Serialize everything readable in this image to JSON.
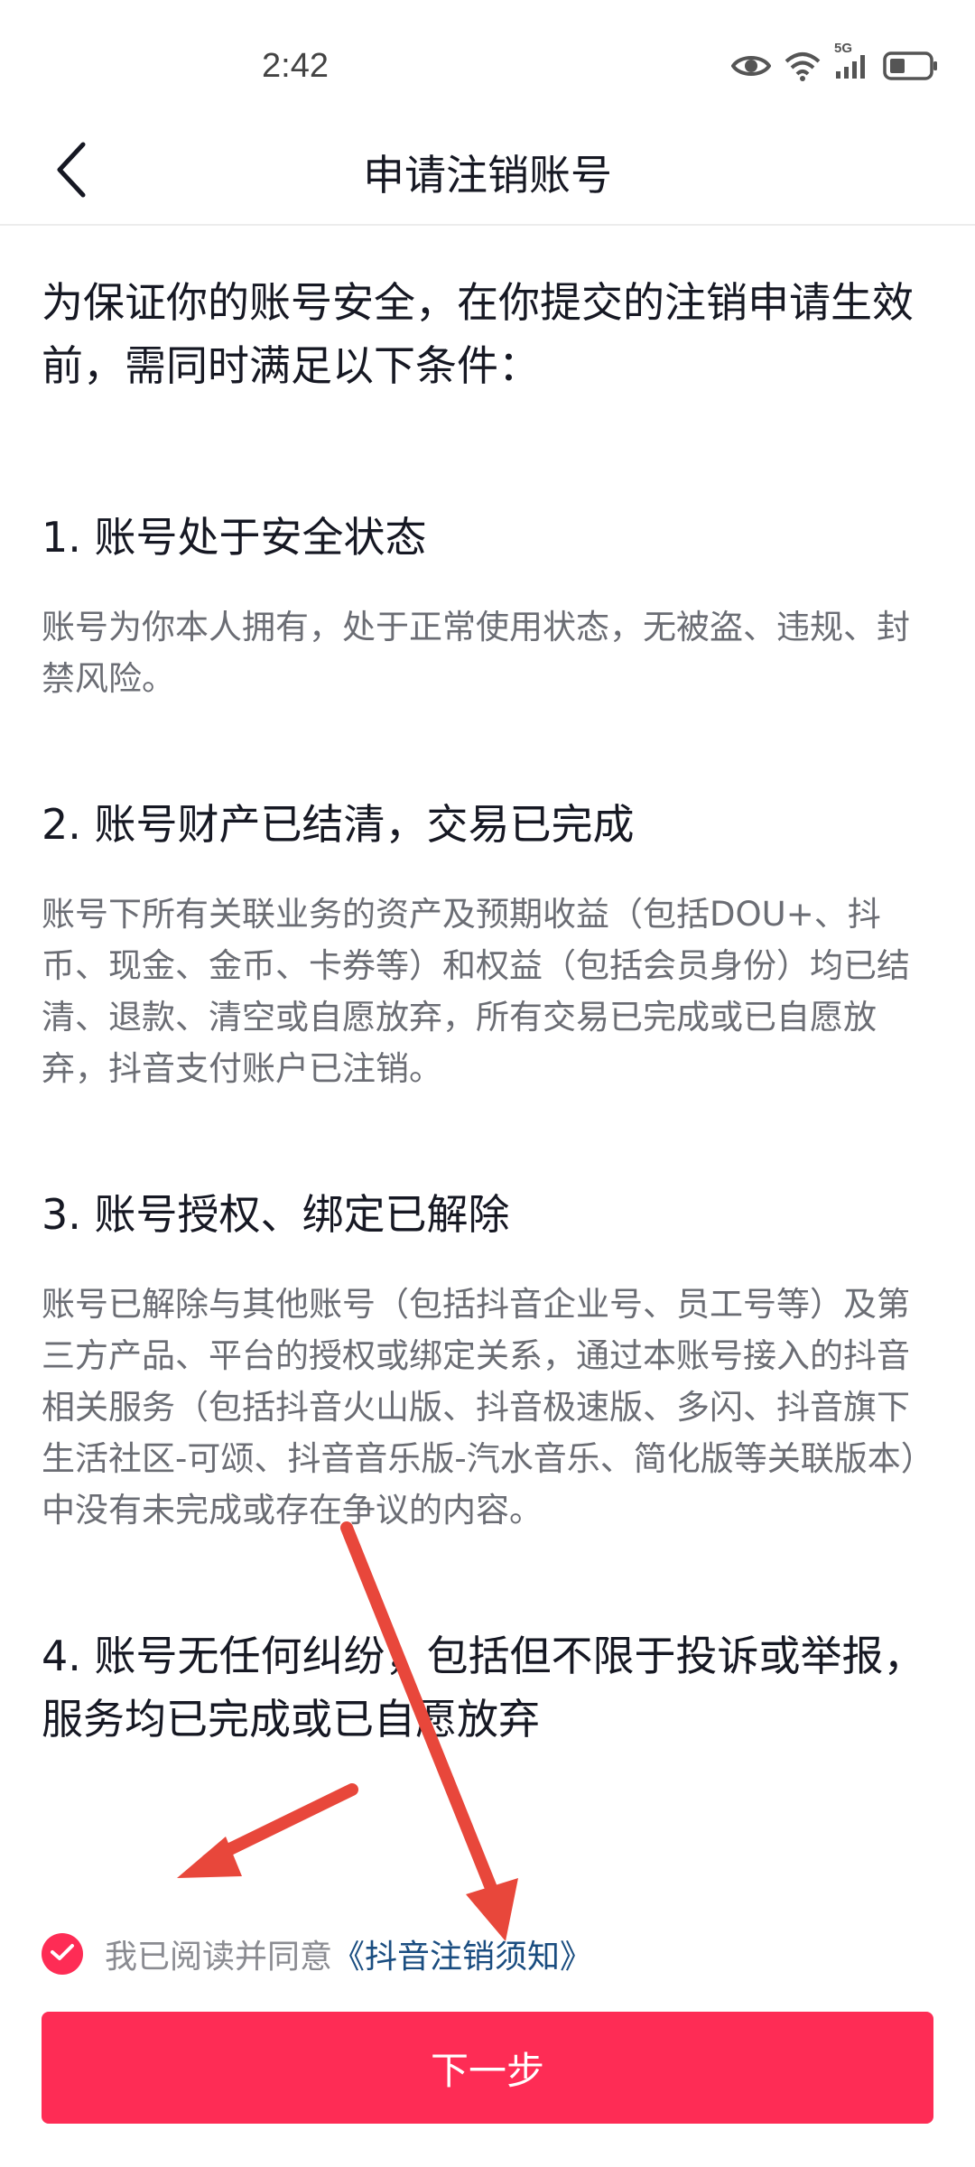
{
  "status_bar": {
    "time": "2:42",
    "network": "5G",
    "icons": [
      "eye-icon",
      "wifi-icon",
      "cellular-signal-icon",
      "battery-icon"
    ]
  },
  "nav": {
    "back_icon": "chevron-left-icon",
    "title": "申请注销账号"
  },
  "content": {
    "intro": "为保证你的账号安全，在你提交的注销申请生效前，需同时满足以下条件：",
    "sections": [
      {
        "heading": "1. 账号处于安全状态",
        "body": "账号为你本人拥有，处于正常使用状态，无被盗、违规、封禁风险。"
      },
      {
        "heading": "2. 账号财产已结清，交易已完成",
        "body": "账号下所有关联业务的资产及预期收益（包括DOU+、抖币、现金、金币、卡券等）和权益（包括会员身份）均已结清、退款、清空或自愿放弃，所有交易已完成或已自愿放弃，抖音支付账户已注销。"
      },
      {
        "heading": "3. 账号授权、绑定已解除",
        "body": "账号已解除与其他账号（包括抖音企业号、员工号等）及第三方产品、平台的授权或绑定关系，通过本账号接入的抖音相关服务（包括抖音火山版、抖音极速版、多闪、抖音旗下生活社区-可颂、抖音音乐版-汽水音乐、简化版等关联版本）中没有未完成或存在争议的内容。"
      },
      {
        "heading": "4. 账号无任何纠纷，包括但不限于投诉或举报，服务均已完成或已自愿放弃",
        "body": ""
      }
    ]
  },
  "agreement": {
    "checked": true,
    "text": "我已阅读并同意",
    "link": "《抖音注销须知》"
  },
  "next_button": {
    "label": "下一步"
  },
  "colors": {
    "accent": "#fe2c55",
    "link": "#1a4d80",
    "annotation_arrow": "#e8473b"
  }
}
